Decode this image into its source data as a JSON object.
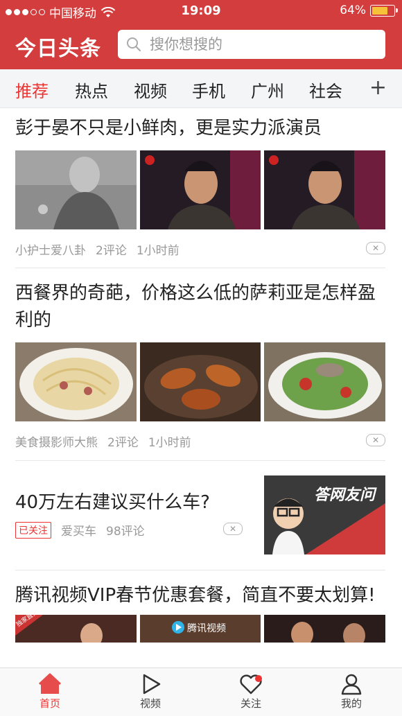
{
  "status_bar": {
    "carrier": "中国移动",
    "time": "19:09",
    "battery": "64%"
  },
  "header": {
    "logo": "今日头条",
    "search_placeholder": "搜你想搜的"
  },
  "tabs": [
    "推荐",
    "热点",
    "视频",
    "手机",
    "广州",
    "社会"
  ],
  "articles": [
    {
      "title": "彭于晏不只是小鲜肉，更是实力派演员",
      "source": "小护士爱八卦",
      "comments": "2评论",
      "time": "1小时前"
    },
    {
      "title": "西餐界的奇葩，价格这么低的萨莉亚是怎样盈利的",
      "source": "美食摄影师大熊",
      "comments": "2评论",
      "time": "1小时前"
    },
    {
      "title": "40万左右建议买什么车?",
      "badge": "已关注",
      "source": "爱买车",
      "comments": "98评论",
      "thumb_text": "答网友问"
    },
    {
      "title": "腾讯视频VIP春节优惠套餐，简直不要太划算!",
      "thumb_labels": [
        "独家直播",
        "腾讯视频"
      ]
    }
  ],
  "bottom_nav": [
    "首页",
    "视频",
    "关注",
    "我的"
  ],
  "colors": {
    "brand_red": "#d43d3d",
    "active_red": "#ee3333"
  }
}
